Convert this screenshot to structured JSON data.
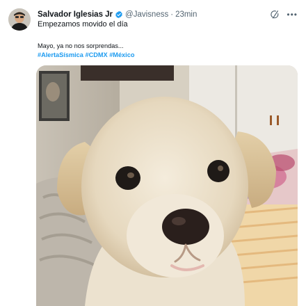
{
  "tweet": {
    "author_name": "Salvador Iglesias Jr",
    "handle": "@Javisness",
    "separator": "·",
    "time": "23min",
    "line1": "Empezamos movido el día",
    "text": "Mayo, ya no nos sorprendas...",
    "hashtags": [
      "#AlertaSísmica",
      "#CDMX",
      "#México"
    ],
    "verified_icon": "verified-badge-icon",
    "grok_icon": "grok-icon",
    "more_icon": "more-icon",
    "accent_color": "#1d9bf0"
  },
  "media": {
    "subject": "white-puppy-photo"
  }
}
